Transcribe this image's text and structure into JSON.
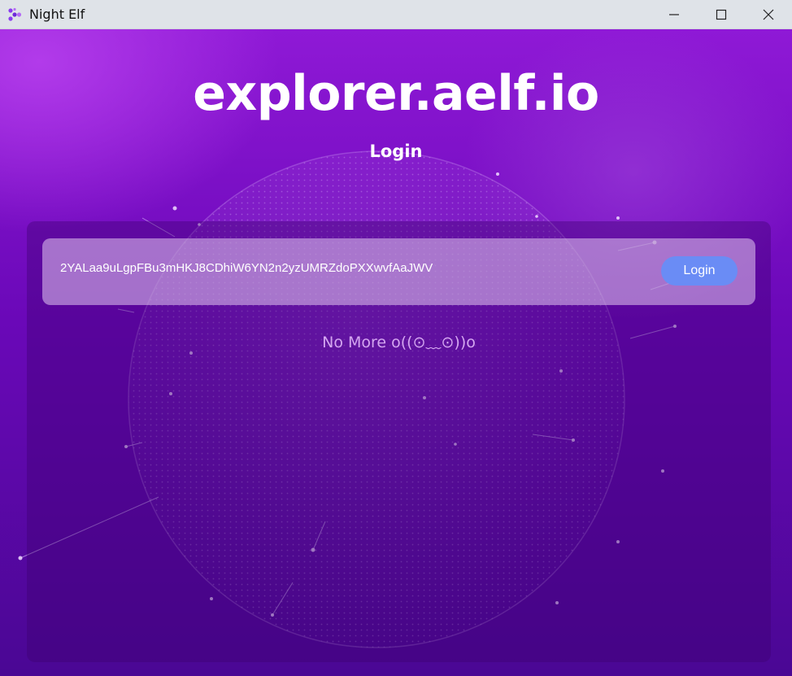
{
  "window": {
    "title": "Night Elf",
    "icons": {
      "app": "night-elf-logo",
      "minimize": "minimize-icon",
      "maximize": "maximize-icon",
      "close": "close-icon"
    }
  },
  "page": {
    "site": "explorer.aelf.io",
    "heading": "Login",
    "empty_message": "No More o((⊙﹏⊙))o"
  },
  "accounts": [
    {
      "address": "2YALaa9uLgpFBu3mHKJ8CDhiW6YN2n2yzUMRZdoPXXwvfAaJWV",
      "action_label": "Login"
    }
  ],
  "colors": {
    "primary_button": "#6a8cf5",
    "background_top": "#8f19d6",
    "background_bottom": "#4a0794",
    "muted_text": "#d4a6f0"
  }
}
